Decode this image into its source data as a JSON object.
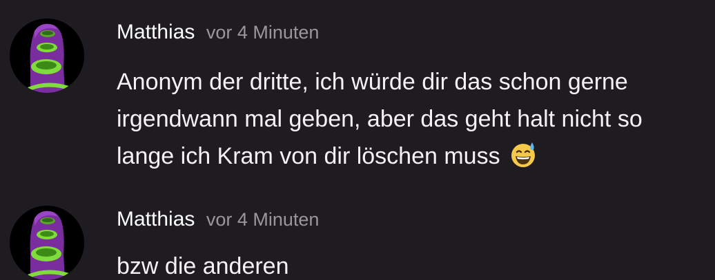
{
  "comments": [
    {
      "author": "Matthias",
      "time": "vor 4 Minuten",
      "text": "Anonym der dritte, ich würde dir das schon gerne irgendwann mal geben, aber das geht halt nicht so lange ich Kram von dir löschen muss",
      "emoji": "grinning-face-with-sweat-icon"
    },
    {
      "author": "Matthias",
      "time": "vor 4 Minuten",
      "text": "bzw die anderen"
    }
  ],
  "colors": {
    "background": "#1f1c21",
    "author": "#ffffff",
    "timestamp": "#9a969c",
    "text": "#f4f2f5",
    "avatar_purple": "#7a2d9e",
    "avatar_green": "#7fdc3a"
  }
}
